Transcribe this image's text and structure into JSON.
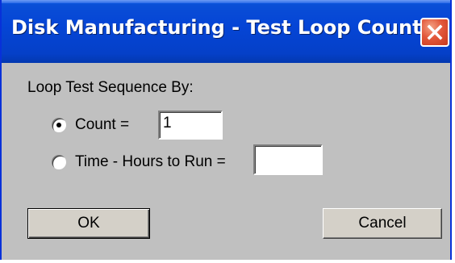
{
  "window": {
    "title": "Disk Manufacturing - Test Loop Count",
    "close_icon": "close-x-icon"
  },
  "group": {
    "label": "Loop Test Sequence By:"
  },
  "options": [
    {
      "label": "Count =",
      "selected": true,
      "value": "1"
    },
    {
      "label": "Time - Hours to Run =",
      "selected": false,
      "value": ""
    }
  ],
  "buttons": {
    "ok_label": "OK",
    "cancel_label": "Cancel"
  },
  "colors": {
    "titlebar": "#0545d6",
    "close_button": "#e2583b",
    "dialog_face": "#c0c0c0"
  }
}
